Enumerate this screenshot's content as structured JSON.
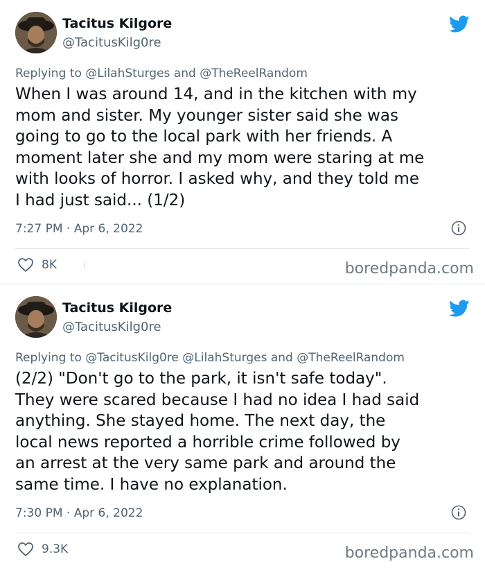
{
  "tweets": [
    {
      "author_name": "Tacitus Kilgore",
      "author_handle": "@TacitusKilg0re",
      "replying_prefix": "Replying to",
      "replying_mentions": [
        "@LilahSturges"
      ],
      "replying_last": "@TheReelRandom",
      "replying_and": "and",
      "text": "When I was around 14, and in the kitchen with my\nmom and sister. My younger sister said she was\ngoing to go to the local park with her friends. A\nmoment later she and my mom were staring at me\nwith looks of horror. I asked why, and they told me\nI had just said... (1/2)",
      "timestamp": "7:27 PM · Apr 6, 2022",
      "likes": "8K"
    },
    {
      "author_name": "Tacitus Kilgore",
      "author_handle": "@TacitusKilg0re",
      "replying_prefix": "Replying to",
      "replying_mentions": [
        "@TacitusKilg0re",
        "@LilahSturges"
      ],
      "replying_last": "@TheReelRandom",
      "replying_and": "and",
      "text": "(2/2) \"Don't go to the park, it isn't safe today\".\nThey were scared because I had no idea I had said\nanything. She stayed home. The next day, the\nlocal news reported a horrible crime followed by\nan arrest at the very same park and around the\nsame time. I have no explanation.",
      "timestamp": "7:30 PM · Apr 6, 2022",
      "likes": "9.3K"
    }
  ],
  "watermark": "boredpanda.com",
  "colors": {
    "twitter_blue": "#1d9bf0",
    "secondary_text": "#536471",
    "watermark_gray": "#6f7a82"
  },
  "icons": {
    "brand": "twitter-bird-icon",
    "info": "info-icon",
    "like": "heart-icon"
  }
}
